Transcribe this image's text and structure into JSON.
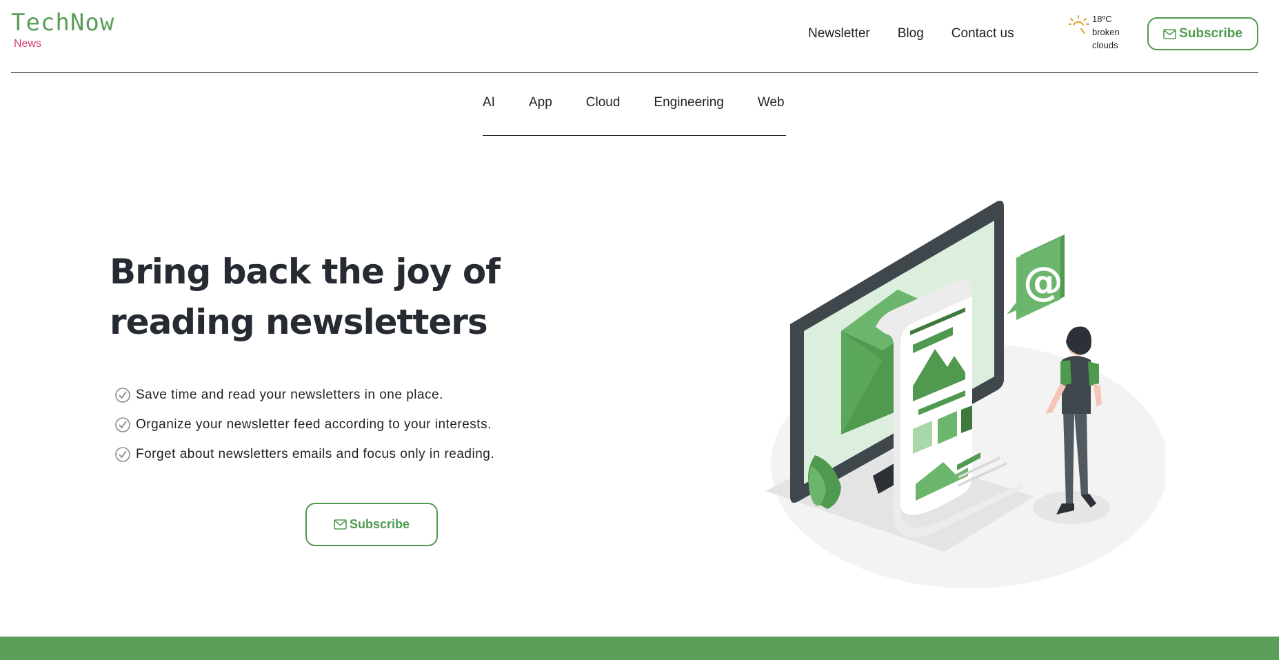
{
  "brand": {
    "name": "TechNow",
    "sub": "News"
  },
  "nav": {
    "items": [
      "Newsletter",
      "Blog",
      "Contact us"
    ]
  },
  "weather": {
    "temp": "18ºC",
    "line1": "broken",
    "line2": "clouds",
    "icon": "sun-icon"
  },
  "header": {
    "subscribe_label": "Subscribe"
  },
  "categories": [
    "AI",
    "App",
    "Cloud",
    "Engineering",
    "Web"
  ],
  "hero": {
    "title": "Bring back the joy of reading newsletters",
    "features": [
      "Save time and read your newsletters in one place.",
      "Organize your newsletter feed according to your interests.",
      "Forget about newsletters emails and focus only in reading."
    ],
    "subscribe_label": "Subscribe"
  },
  "colors": {
    "brand_green": "#4f9a4f",
    "accent_pink": "#d63c6e",
    "footer_green": "#5a9e5a",
    "weather_icon": "#e0a030"
  }
}
